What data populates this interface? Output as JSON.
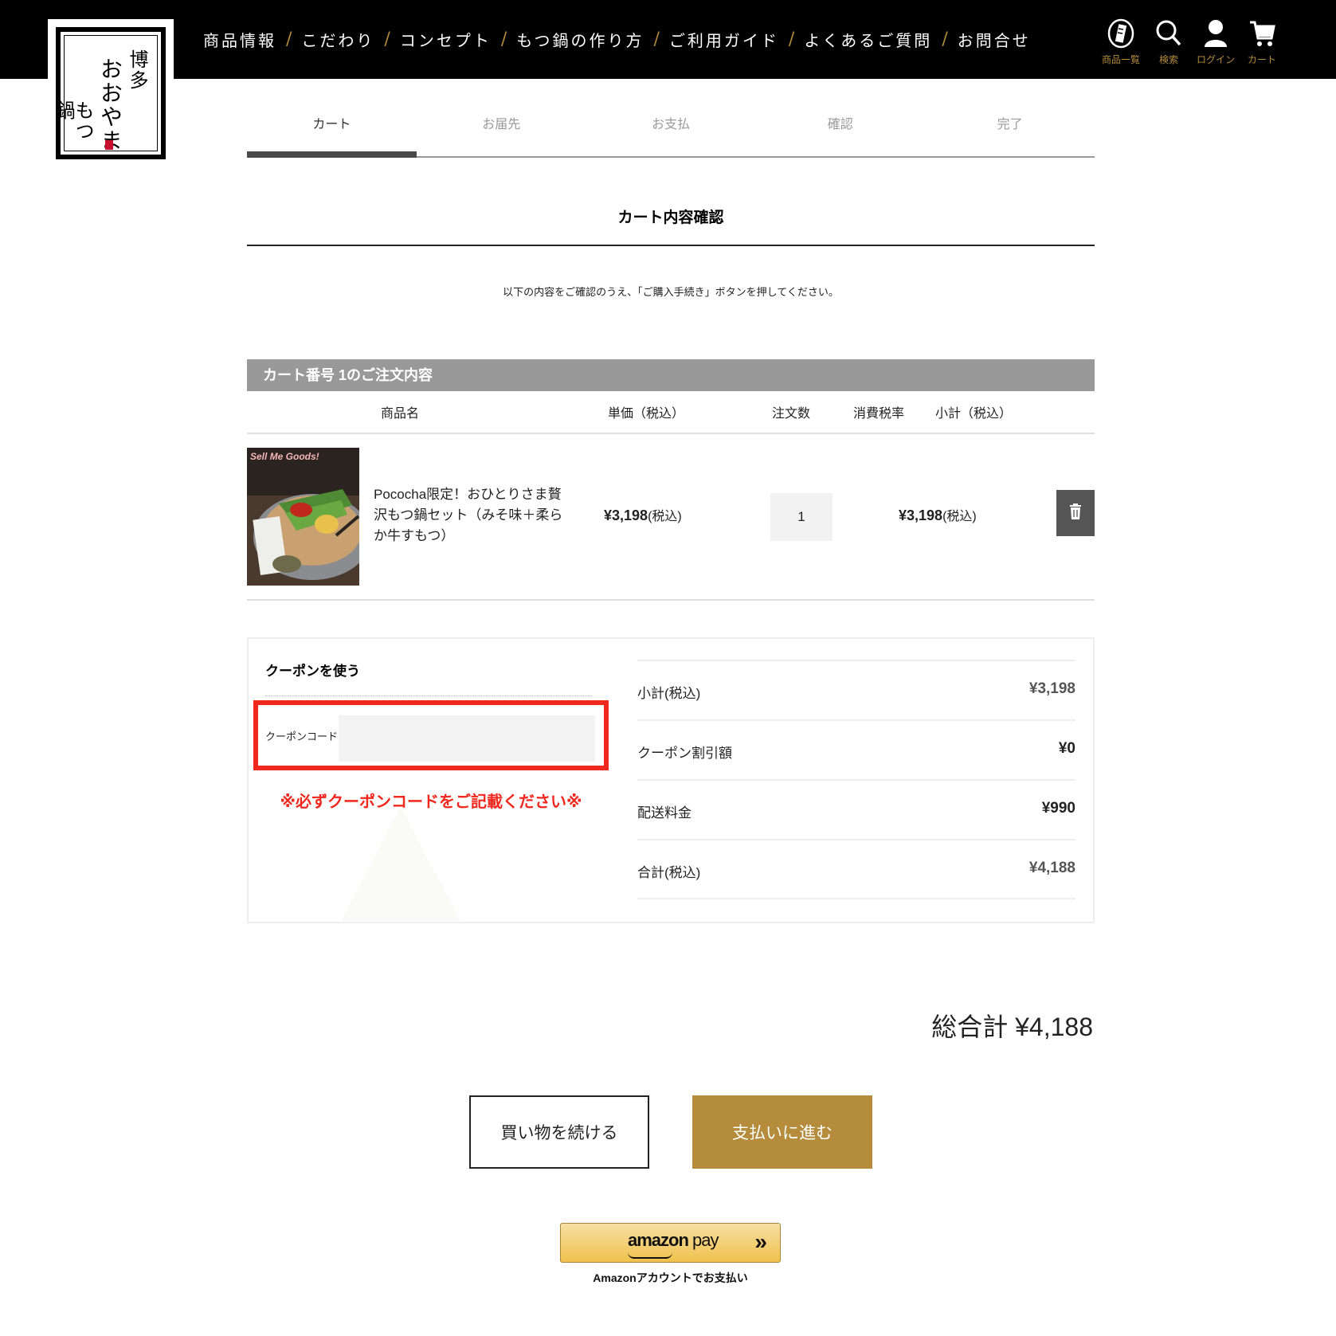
{
  "logo": {
    "text": [
      "博多",
      "おおやま",
      "もつ鍋"
    ],
    "seal_color": "#c8102e"
  },
  "nav": [
    {
      "label": "商品情報"
    },
    {
      "label": "こだわり"
    },
    {
      "label": "コンセプト"
    },
    {
      "label": "もつ鍋の作り方"
    },
    {
      "label": "ご利用ガイド"
    },
    {
      "label": "よくあるご質問"
    },
    {
      "label": "お問合せ"
    }
  ],
  "nav_separator": "/",
  "header_icons": [
    {
      "name": "product-list-icon",
      "label": "商品一覧"
    },
    {
      "name": "search-icon",
      "label": "検索"
    },
    {
      "name": "user-icon",
      "label": "ログイン"
    },
    {
      "name": "cart-icon",
      "label": "カート"
    }
  ],
  "steps": [
    {
      "label": "カート",
      "active": true
    },
    {
      "label": "お届先",
      "active": false
    },
    {
      "label": "お支払",
      "active": false
    },
    {
      "label": "確認",
      "active": false
    },
    {
      "label": "完了",
      "active": false
    }
  ],
  "page_title": "カート内容確認",
  "intro": "以下の内容をご確認のうえ、「ご購入手続き」ボタンを押してください。",
  "cart": {
    "heading": "カート番号 1のご注文内容",
    "columns": {
      "name": "商品名",
      "unit_price": "単価（税込）",
      "quantity": "注文数",
      "tax_rate": "消費税率",
      "subtotal": "小計（税込）"
    },
    "items": [
      {
        "image_caption": "Sell Me Goods!",
        "name": "Pococha限定！おひとりさま贅沢もつ鍋セット（みそ味＋柔らか牛すもつ）",
        "unit_price": "¥3,198",
        "unit_price_tax": "(税込)",
        "quantity": "1",
        "subtotal": "¥3,198",
        "subtotal_tax": "(税込)",
        "delete_icon": "trash-icon"
      }
    ]
  },
  "coupon": {
    "title": "クーポンを使う",
    "code_label": "クーポンコード",
    "code_value": "",
    "note": "※必ずクーポンコードをご記載ください※",
    "highlight_color": "#f0281e"
  },
  "summary": [
    {
      "label": "小計(税込)",
      "value": "¥3,198"
    },
    {
      "label": "クーポン割引額",
      "value": "¥0"
    },
    {
      "label": "配送料金",
      "value": "¥990"
    },
    {
      "label": "合計(税込)",
      "value": "¥4,188"
    }
  ],
  "grand_total": {
    "label": "総合計",
    "value": "¥4,188"
  },
  "buttons": {
    "continue_shopping": "買い物を続ける",
    "proceed_payment": "支払いに進む"
  },
  "amazon": {
    "logo": "amazon",
    "logo_pay": "pay",
    "arrow": "»",
    "caption": "Amazonアカウントでお支払い"
  },
  "colors": {
    "header_bg": "#000000",
    "accent_gold": "#b48c3c",
    "cart_head_bg": "#999999"
  }
}
